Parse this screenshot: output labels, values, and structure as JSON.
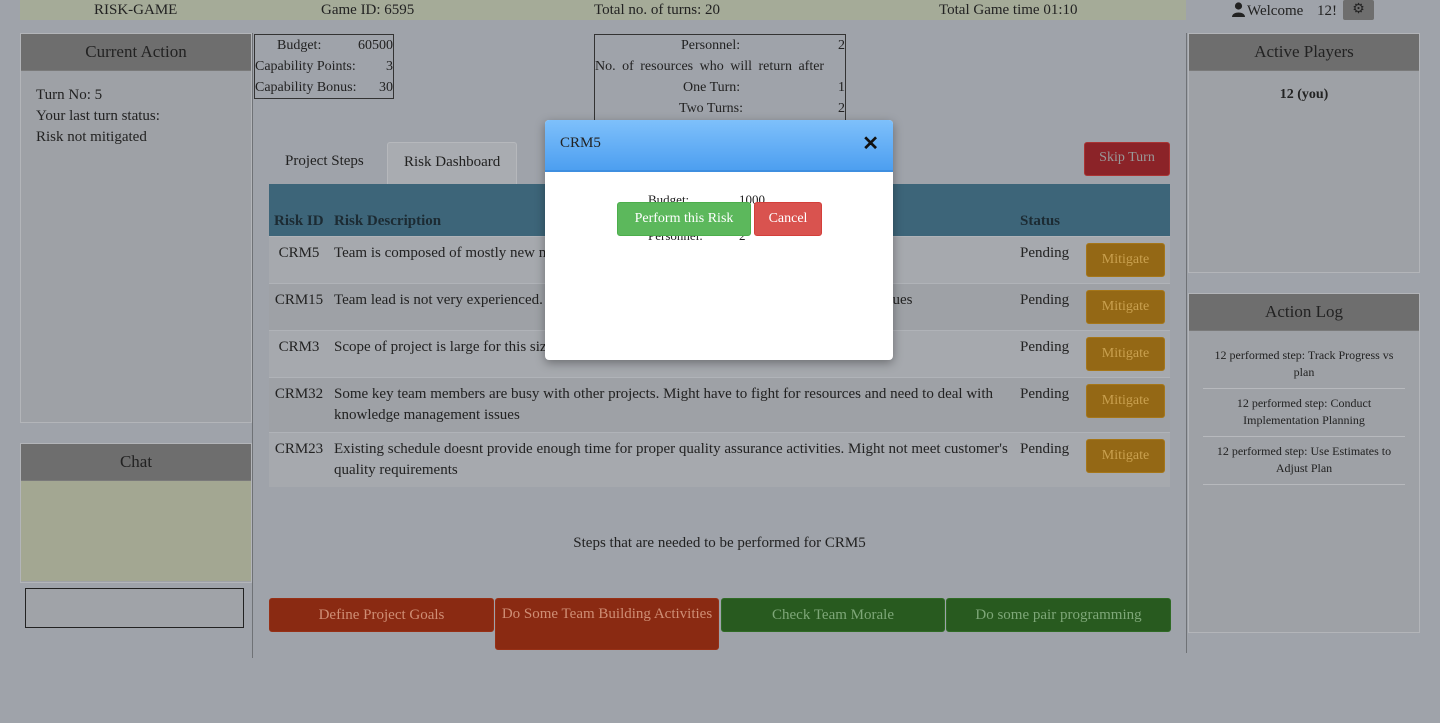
{
  "topbar": {
    "app_title": "RISK-GAME",
    "game_id": "Game ID: 6595",
    "total_turns": "Total no. of turns: 20",
    "total_time": "Total Game time 01:10",
    "welcome": "Welcome",
    "username": "12!"
  },
  "current_action": {
    "title": "Current Action",
    "turn_no": "Turn No: 5",
    "last_status_label": "Your last turn status:",
    "last_status": "Risk not mitigated"
  },
  "chat": {
    "title": "Chat",
    "input_value": ""
  },
  "resources": {
    "budget_label": "Budget:",
    "budget_value": "60500",
    "cap_points_label": "Capability Points:",
    "cap_points_value": "3",
    "cap_bonus_label": "Capability Bonus:",
    "cap_bonus_value": "30"
  },
  "personnel": {
    "label": "Personnel:",
    "value": "2",
    "return_label": "No. of resources who will return after",
    "one_turn_label": "One Turn:",
    "one_turn_value": "1",
    "two_turns_label": "Two Turns:",
    "two_turns_value": "2"
  },
  "tabs": {
    "project_steps": "Project Steps",
    "risk_dashboard": "Risk Dashboard"
  },
  "skip_turn": "Skip Turn",
  "risk_table": {
    "headers": {
      "id": "Risk ID",
      "description": "Risk Description",
      "status": "Status"
    },
    "mitigate_label": "Mitigate",
    "rows": [
      {
        "id": "CRM5",
        "description": "Team is composed of mostly new members. Might have issues with team building",
        "status": "Pending"
      },
      {
        "id": "CRM15",
        "description": "Team lead is not very experienced. Might not be able to manage workload and ineffiiency issues",
        "status": "Pending"
      },
      {
        "id": "CRM3",
        "description": "Scope of project is large for this size team.might not be able to finish project on time",
        "status": "Pending"
      },
      {
        "id": "CRM32",
        "description": "Some key team members are busy with other projects. Might have to fight for resources and need to deal with knowledge management issues",
        "status": "Pending"
      },
      {
        "id": "CRM23",
        "description": "Existing schedule doesnt provide enough time for proper quality assurance activities. Might not meet customer's quality requirements",
        "status": "Pending"
      }
    ]
  },
  "steps_caption": "Steps that are needed to be performed for CRM5",
  "steps": [
    {
      "label": "Define Project Goals",
      "color": "#8a2a12"
    },
    {
      "label": "Do Some Team Building Activities",
      "color": "#8a2a12"
    },
    {
      "label": "Check Team Morale",
      "color": "#285a1f"
    },
    {
      "label": "Do some pair programming",
      "color": "#285a1f"
    }
  ],
  "active_players": {
    "title": "Active Players",
    "player": "12 (you)"
  },
  "action_log": {
    "title": "Action Log",
    "items": [
      "12 performed step: Track Progress vs plan",
      "12 performed step: Conduct Implementation Planning",
      "12 performed step: Use Estimates to Adjust Plan"
    ]
  },
  "modal": {
    "title": "CRM5",
    "budget_label": "Budget:",
    "budget_value": "1000",
    "personnel_label": "Personnel:",
    "personnel_value": "2",
    "perform_label": "Perform this Risk",
    "cancel_label": "Cancel"
  }
}
